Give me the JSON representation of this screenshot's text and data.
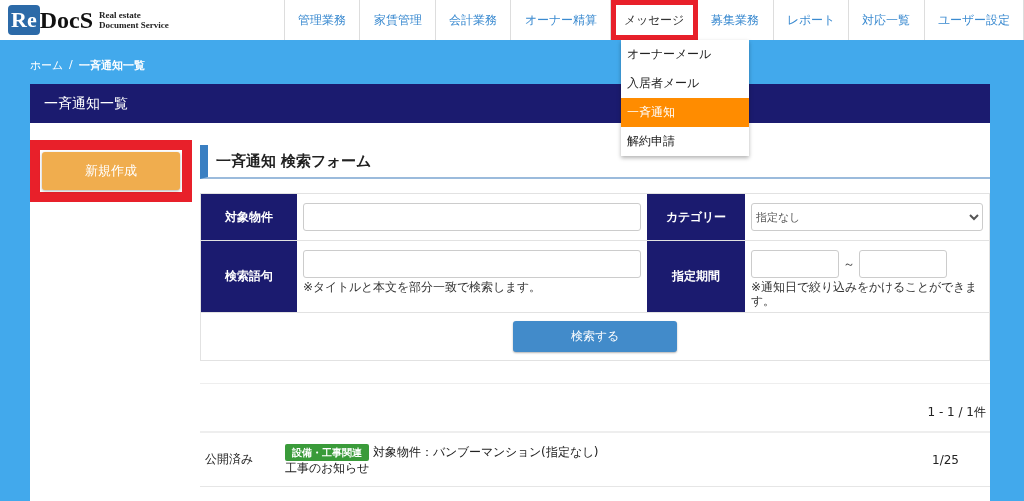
{
  "logo": {
    "mark": "Re",
    "name": "DocS",
    "tagline_1": "Real estate",
    "tagline_2": "Document Service"
  },
  "nav": [
    {
      "label": "管理業務",
      "selected": false,
      "highlighted": false
    },
    {
      "label": "家賃管理",
      "selected": false,
      "highlighted": false
    },
    {
      "label": "会計業務",
      "selected": false,
      "highlighted": false
    },
    {
      "label": "オーナー精算",
      "selected": false,
      "highlighted": false
    },
    {
      "label": "メッセージ",
      "selected": true,
      "highlighted": true
    },
    {
      "label": "募集業務",
      "selected": false,
      "highlighted": false
    },
    {
      "label": "レポート",
      "selected": false,
      "highlighted": false
    },
    {
      "label": "対応一覧",
      "selected": false,
      "highlighted": false
    },
    {
      "label": "ユーザー設定",
      "selected": false,
      "highlighted": false
    }
  ],
  "dropdown": [
    {
      "label": "オーナーメール",
      "selected": false
    },
    {
      "label": "入居者メール",
      "selected": false
    },
    {
      "label": "一斉通知",
      "selected": true
    },
    {
      "label": "解約申請",
      "selected": false
    }
  ],
  "breadcrumb": [
    "ホーム",
    "/",
    "一斉通知一覧"
  ],
  "panel_title": "一斉通知一覧",
  "new_button": {
    "label": "新規作成",
    "highlighted": true
  },
  "form_title": "一斉通知 検索フォーム",
  "form": {
    "property_label": "対象物件",
    "category_label": "カテゴリー",
    "category_value": "指定なし",
    "keyword_label": "検索語句",
    "keyword_hint": "※タイトルと本文を部分一致で検索します。",
    "period_label": "指定期間",
    "period_sep": "～",
    "period_hint": "※通知日で絞り込みをかけることができます。",
    "search_button": "検索する"
  },
  "result_count": "1 - 1 / 1件",
  "rows": [
    {
      "status": "公開済み",
      "tag": "設備・工事関連",
      "color": "#3a9b3a",
      "target": "対象物件：バンブーマンション(指定なし)",
      "title": "工事のお知らせ",
      "date": "1/25"
    }
  ]
}
